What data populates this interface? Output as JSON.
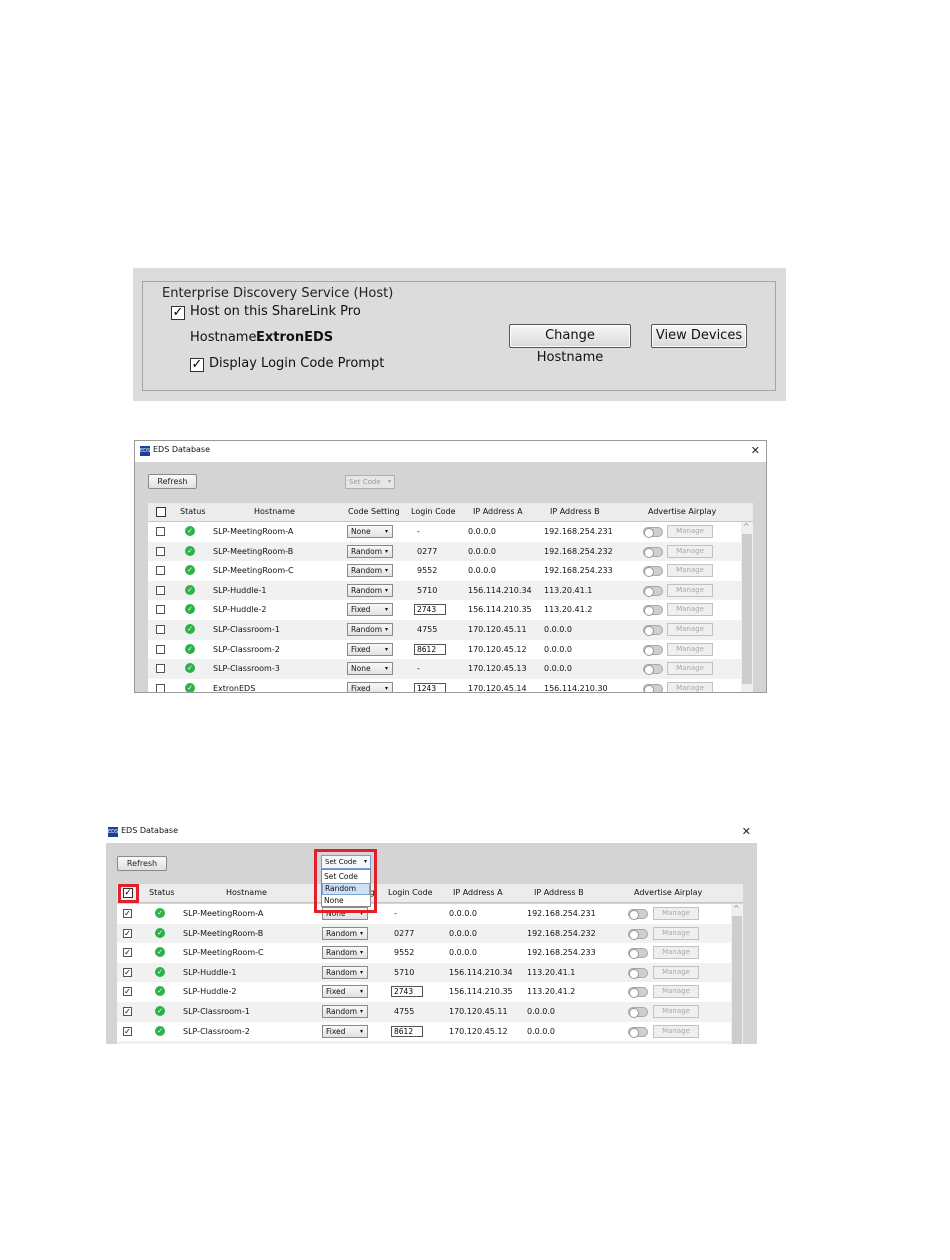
{
  "host_panel": {
    "group_title": "Enterprise Discovery Service (Host)",
    "host_checkbox_label": "Host on this ShareLink Pro",
    "hostname_label": "Hostname:",
    "hostname_value": "ExtronEDS",
    "login_prompt_label": "Display Login Code Prompt",
    "change_hostname_button": "Change Hostname",
    "view_devices_button": "View Devices",
    "check_mark": "✓"
  },
  "eds_window": {
    "icon_text": "EDS",
    "title": "EDS Database",
    "close": "✕",
    "refresh_button": "Refresh",
    "set_code_label": "Set Code",
    "columns": [
      "Status",
      "Hostname",
      "Code Setting",
      "Login Code",
      "IP Address A",
      "IP Address B",
      "Advertise Airplay"
    ],
    "manage_label": "Manage",
    "status_glyph": "✓",
    "arrow": "▾",
    "scroll_up": "^"
  },
  "devices": [
    {
      "hostname": "SLP-MeetingRoom-A",
      "code_setting": "None",
      "login_code": "-",
      "ip_a": "0.0.0.0",
      "ip_b": "192.168.254.231"
    },
    {
      "hostname": "SLP-MeetingRoom-B",
      "code_setting": "Random",
      "login_code": "0277",
      "ip_a": "0.0.0.0",
      "ip_b": "192.168.254.232"
    },
    {
      "hostname": "SLP-MeetingRoom-C",
      "code_setting": "Random",
      "login_code": "9552",
      "ip_a": "0.0.0.0",
      "ip_b": "192.168.254.233"
    },
    {
      "hostname": "SLP-Huddle-1",
      "code_setting": "Random",
      "login_code": "5710",
      "ip_a": "156.114.210.34",
      "ip_b": "113.20.41.1"
    },
    {
      "hostname": "SLP-Huddle-2",
      "code_setting": "Fixed",
      "login_code": "2743",
      "ip_a": "156.114.210.35",
      "ip_b": "113.20.41.2"
    },
    {
      "hostname": "SLP-Classroom-1",
      "code_setting": "Random",
      "login_code": "4755",
      "ip_a": "170.120.45.11",
      "ip_b": "0.0.0.0"
    },
    {
      "hostname": "SLP-Classroom-2",
      "code_setting": "Fixed",
      "login_code": "8612",
      "ip_a": "170.120.45.12",
      "ip_b": "0.0.0.0"
    },
    {
      "hostname": "SLP-Classroom-3",
      "code_setting": "None",
      "login_code": "-",
      "ip_a": "170.120.45.13",
      "ip_b": "0.0.0.0"
    },
    {
      "hostname": "ExtronEDS",
      "code_setting": "Fixed",
      "login_code": "1243",
      "ip_a": "170.120.45.14",
      "ip_b": "156.114.210.30"
    }
  ],
  "set_code_dropdown": {
    "selected": "Set Code",
    "options": [
      "Set Code",
      "Random",
      "None"
    ],
    "highlighted": "Random"
  }
}
